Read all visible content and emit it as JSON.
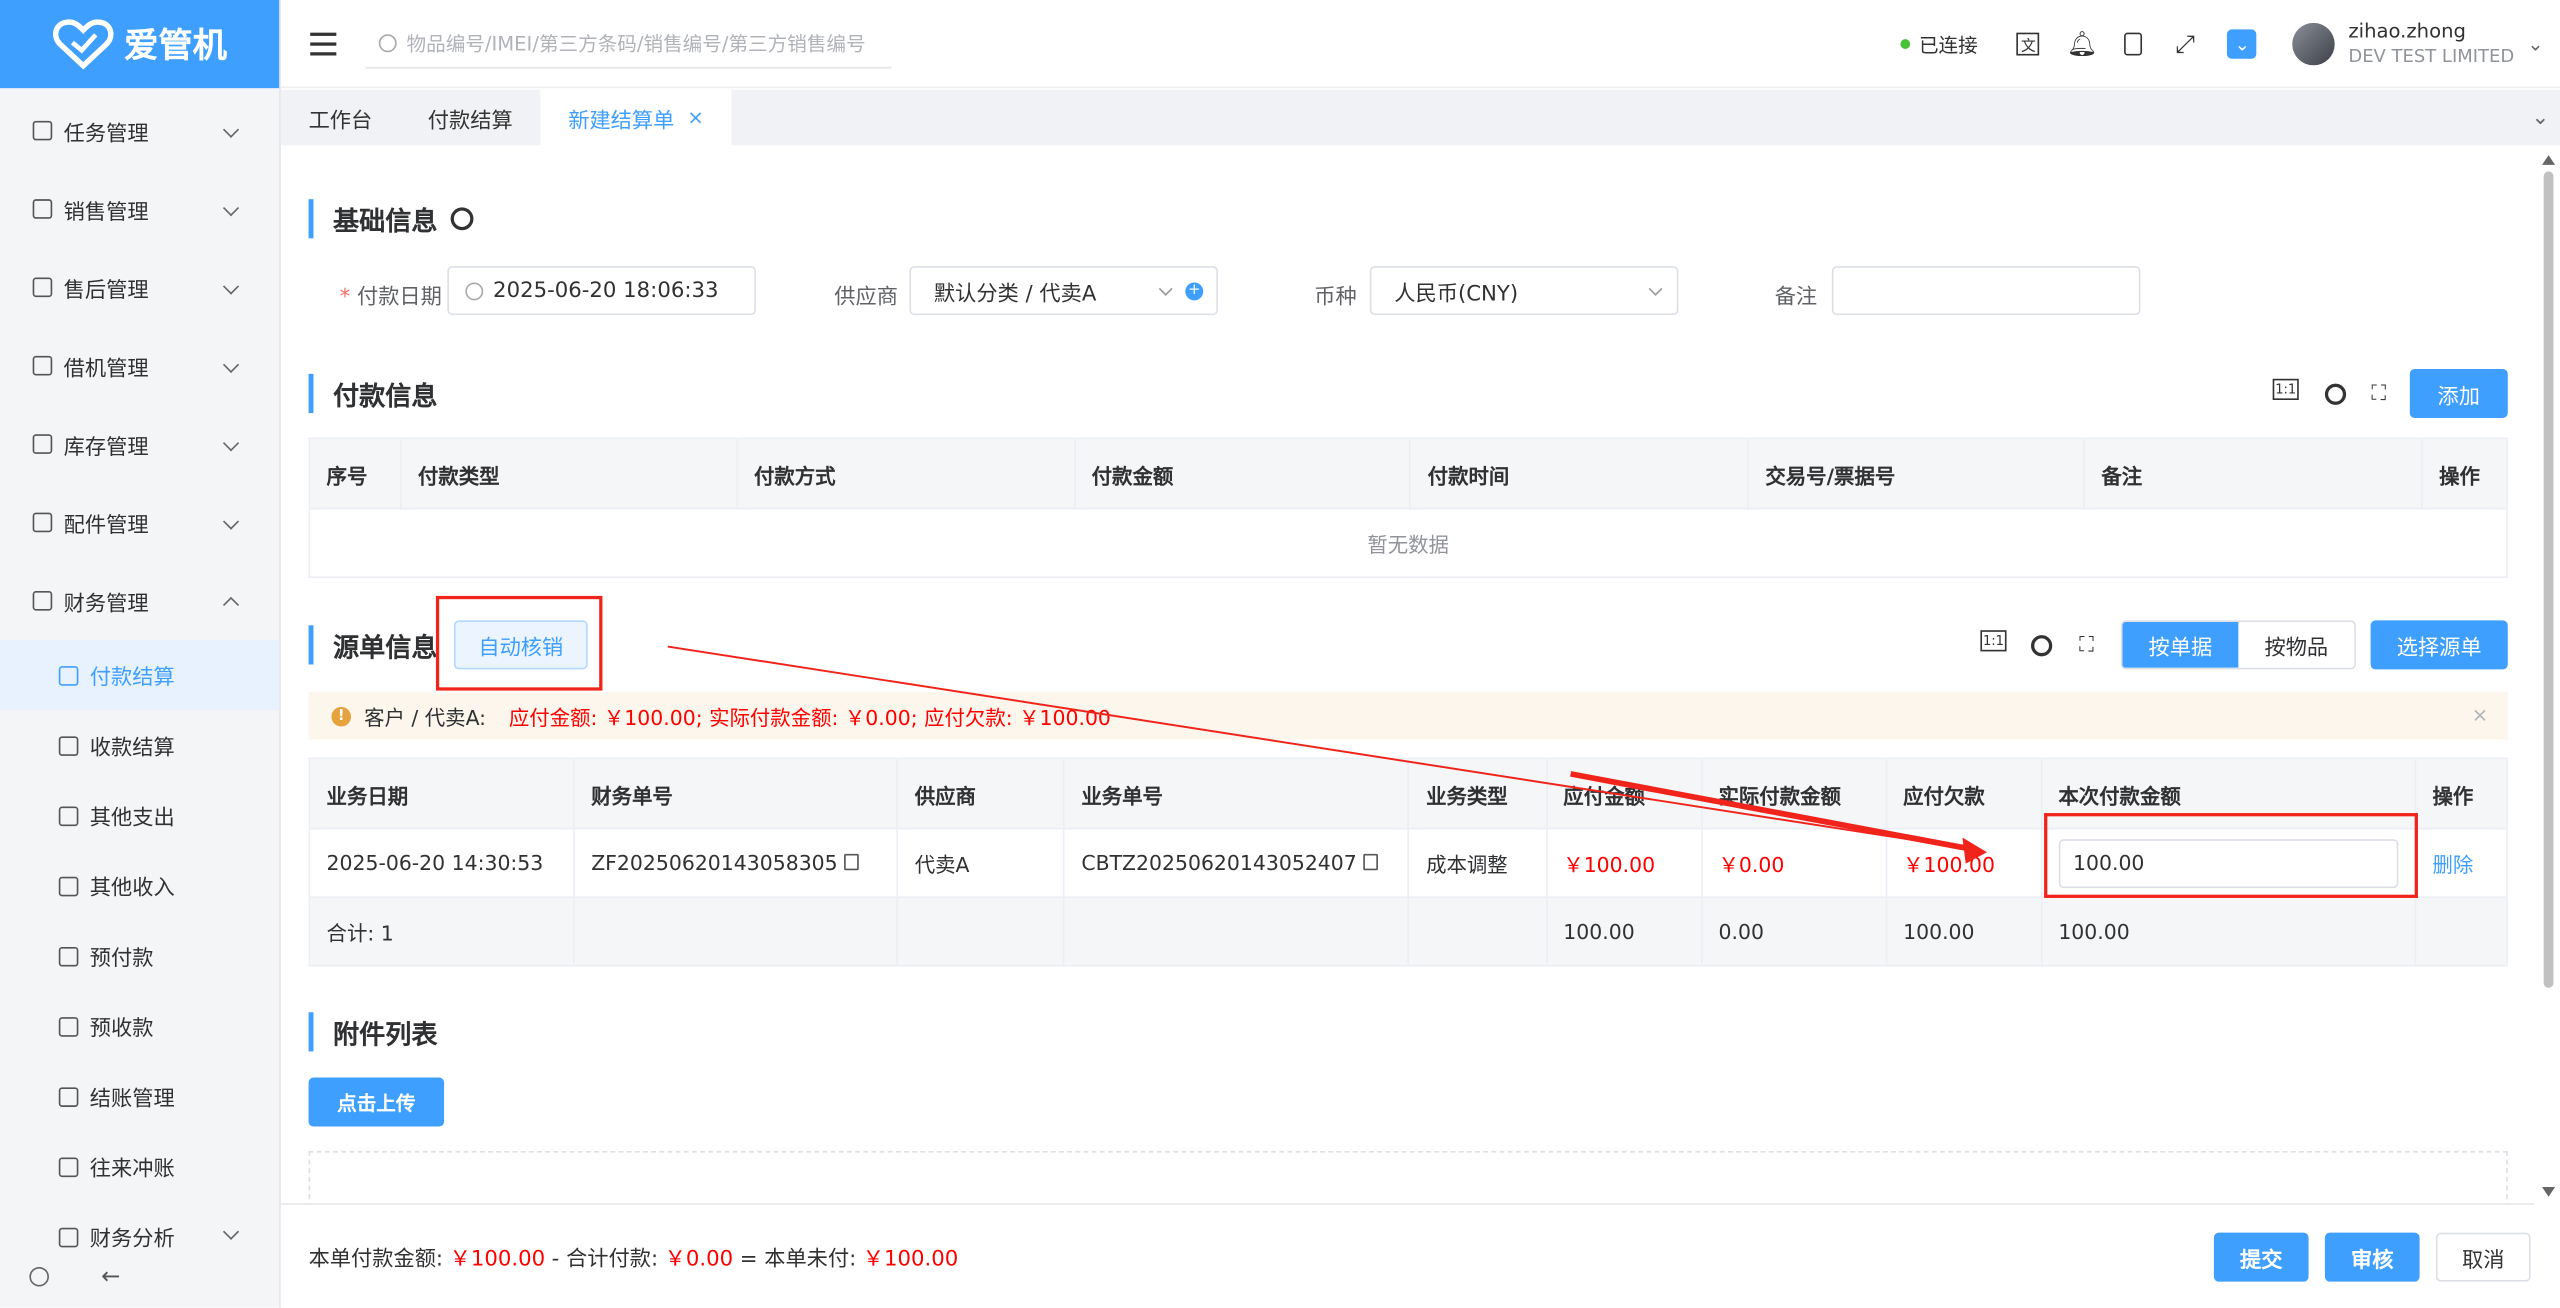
{
  "app": {
    "brand": "爱管机"
  },
  "sidebar": {
    "items": [
      {
        "label": "任务管理",
        "icon": "task-icon"
      },
      {
        "label": "销售管理",
        "icon": "sales-icon"
      },
      {
        "label": "售后管理",
        "icon": "after-sales-icon"
      },
      {
        "label": "借机管理",
        "icon": "phone-icon"
      },
      {
        "label": "库存管理",
        "icon": "warehouse-icon"
      },
      {
        "label": "配件管理",
        "icon": "parts-icon"
      },
      {
        "label": "财务管理",
        "icon": "finance-icon"
      }
    ],
    "finance_sub": [
      {
        "label": "付款结算",
        "icon": "payment-icon"
      },
      {
        "label": "收款结算",
        "icon": "receipt-icon"
      },
      {
        "label": "其他支出",
        "icon": "expense-icon"
      },
      {
        "label": "其他收入",
        "icon": "income-icon"
      },
      {
        "label": "预付款",
        "icon": "prepay-icon"
      },
      {
        "label": "预收款",
        "icon": "prereceive-icon"
      },
      {
        "label": "结账管理",
        "icon": "history-icon"
      },
      {
        "label": "往来冲账",
        "icon": "offset-icon"
      }
    ],
    "last_item": {
      "label": "财务分析",
      "icon": "chart-icon"
    }
  },
  "topbar": {
    "search_placeholder": "物品编号/IMEI/第三方条码/销售编号/第三方销售编号",
    "status": "已连接",
    "user_name": "zihao.zhong",
    "company": "DEV TEST LIMITED"
  },
  "tabs": [
    {
      "label": "工作台"
    },
    {
      "label": "付款结算"
    },
    {
      "label": "新建结算单",
      "close": "×"
    }
  ],
  "basic": {
    "title": "基础信息",
    "date_label": "付款日期",
    "date_required": "*",
    "date_value": "2025-06-20 18:06:33",
    "supplier_label": "供应商",
    "supplier_value": "默认分类 / 代卖A",
    "currency_label": "币种",
    "currency_value": "人民币(CNY)",
    "remark_label": "备注",
    "remark_value": ""
  },
  "payment": {
    "title": "付款信息",
    "add_label": "添加",
    "columns": [
      "序号",
      "付款类型",
      "付款方式",
      "付款金额",
      "付款时间",
      "交易号/票据号",
      "备注",
      "操作"
    ],
    "empty_text": "暂无数据"
  },
  "source": {
    "title": "源单信息",
    "auto_label": "自动核销",
    "by_document": "按单据",
    "by_item": "按物品",
    "select_label": "选择源单",
    "alert_party": "客户 / 代卖A:",
    "alert_detail": "应付金额: ￥100.00; 实际付款金额: ￥0.00; 应付欠款: ￥100.00",
    "columns": [
      "业务日期",
      "财务单号",
      "供应商",
      "业务单号",
      "业务类型",
      "应付金额",
      "实际付款金额",
      "应付欠款",
      "本次付款金额",
      "操作"
    ],
    "rows": [
      {
        "date": "2025-06-20 14:30:53",
        "fin_no": "ZF20250620143058305",
        "supplier": "代卖A",
        "biz_no": "CBTZ20250620143052407",
        "biz_type": "成本调整",
        "payable": "￥100.00",
        "actual": "￥0.00",
        "owed": "￥100.00",
        "this_payment": "100.00",
        "action": "删除"
      }
    ],
    "total": {
      "label": "合计: 1",
      "payable": "100.00",
      "actual": "0.00",
      "owed": "100.00",
      "this_payment": "100.00"
    }
  },
  "attachments": {
    "title": "附件列表",
    "upload_label": "点击上传"
  },
  "footer": {
    "label1": "本单付款金额:",
    "amount1": "￥100.00",
    "sep1": "- 合计付款:",
    "amount2": "￥0.00",
    "sep2": "= 本单未付:",
    "amount3": "￥100.00",
    "submit": "提交",
    "review": "审核",
    "cancel": "取消"
  },
  "colors": {
    "accent": "#3f9fff",
    "danger": "#ff0000",
    "annotation": "#f0241b"
  }
}
